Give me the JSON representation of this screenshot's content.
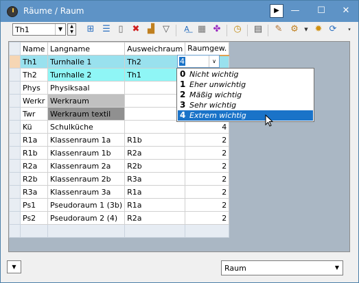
{
  "window": {
    "title": "Räume / Raum",
    "controls": {
      "play_icon": "▶",
      "minimize": "—",
      "maximize": "☐",
      "close": "✕"
    }
  },
  "toolbar": {
    "selector_value": "Th1",
    "icons": [
      "new-row-icon",
      "list-icon",
      "new-document-icon",
      "delete-icon",
      "sort-icon",
      "filter-icon",
      "spellcheck-icon",
      "table-icon",
      "molecule-icon",
      "clock-icon",
      "calendar-icon",
      "palette-icon",
      "settings-dropdown-icon",
      "gear-icon",
      "refresh-icon"
    ]
  },
  "grid": {
    "columns": [
      "Name",
      "Langname",
      "Ausweichraum",
      "Raumgew."
    ],
    "rows": [
      {
        "name": "Th1",
        "lang": "Turnhalle 1",
        "aus": "Th2",
        "gew": "4"
      },
      {
        "name": "Th2",
        "lang": "Turnhalle 2",
        "aus": "Th1",
        "gew": ""
      },
      {
        "name": "Phys",
        "lang": "Physiksaal",
        "aus": "",
        "gew": ""
      },
      {
        "name": "Werkr",
        "lang": "Werkraum",
        "aus": "",
        "gew": ""
      },
      {
        "name": "Twr",
        "lang": "Werkraum textil",
        "aus": "",
        "gew": ""
      },
      {
        "name": "Kü",
        "lang": "Schulküche",
        "aus": "",
        "gew": "4"
      },
      {
        "name": "R1a",
        "lang": "Klassenraum 1a",
        "aus": "R1b",
        "gew": "2"
      },
      {
        "name": "R1b",
        "lang": "Klassenraum 1b",
        "aus": "R2a",
        "gew": "2"
      },
      {
        "name": "R2a",
        "lang": "Klassenraum 2a",
        "aus": "R2b",
        "gew": "2"
      },
      {
        "name": "R2b",
        "lang": "Klassenraum 2b",
        "aus": "R3a",
        "gew": "2"
      },
      {
        "name": "R3a",
        "lang": "Klassenraum 3a",
        "aus": "R1a",
        "gew": "2"
      },
      {
        "name": "Ps1",
        "lang": "Pseudoraum 1 (3b)",
        "aus": "R1a",
        "gew": "2"
      },
      {
        "name": "Ps2",
        "lang": "Pseudoraum 2 (4)",
        "aus": "R2a",
        "gew": "2"
      }
    ],
    "editing_value": "4"
  },
  "dropdown": {
    "options": [
      {
        "key": "0",
        "label": "Nicht wichtig"
      },
      {
        "key": "1",
        "label": "Eher unwichtig"
      },
      {
        "key": "2",
        "label": "Mäßig wichtig"
      },
      {
        "key": "3",
        "label": "Sehr wichtig"
      },
      {
        "key": "4",
        "label": "Extrem wichtig"
      }
    ],
    "selected_index": 4
  },
  "footer": {
    "type_value": "Raum"
  },
  "colors": {
    "titlebar": "#5e93c6",
    "selection": "#1a73c8"
  }
}
